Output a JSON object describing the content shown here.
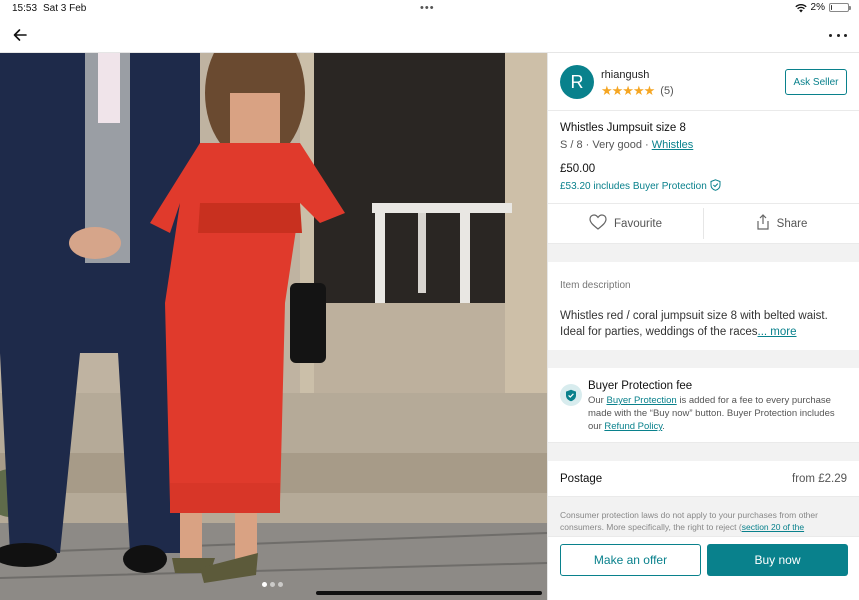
{
  "status_bar": {
    "time": "15:53",
    "date": "Sat 3 Feb",
    "battery": "2%",
    "battery_level": 0.02,
    "wifi_icon": "wifi-icon"
  },
  "nav": {
    "back_icon": "arrow-left-icon",
    "more_icon": "more-horizontal-icon"
  },
  "photo": {
    "carousel_count": 3,
    "active_index": 0
  },
  "seller": {
    "initial": "R",
    "name": "rhiangush",
    "stars": "★★★★★",
    "rating": 5,
    "review_count": "(5)",
    "ask_button": "Ask Seller"
  },
  "item": {
    "title": "Whistles Jumpsuit size 8",
    "size_condition": "S / 8 · Very good · ",
    "brand": "Whistles",
    "price": "£50.00",
    "protection_price": "£53.20 includes Buyer Protection"
  },
  "actions": {
    "favourite": "Favourite",
    "share": "Share"
  },
  "description": {
    "label": "Item description",
    "text": "Whistles red / coral  jumpsuit size 8 with belted waist. Ideal for parties, weddings of the races",
    "more": "... more"
  },
  "buyer_protection": {
    "title": "Buyer Protection fee",
    "text_1": "Our ",
    "link_1": "Buyer Protection",
    "text_2": " is added for a fee to every purchase made with the “Buy now” button. Buyer Protection includes our ",
    "link_2": "Refund Policy",
    "text_3": "."
  },
  "postage": {
    "label": "Postage",
    "value": "from £2.29"
  },
  "consumer": {
    "text": "Consumer protection laws do not apply to your purchases from other consumers. More specifically, the right to reject (",
    "link": "section 20 of the"
  },
  "bottom_bar": {
    "offer": "Make an offer",
    "buy": "Buy now"
  },
  "colors": {
    "accent": "#09818c",
    "star": "#f5a623"
  }
}
